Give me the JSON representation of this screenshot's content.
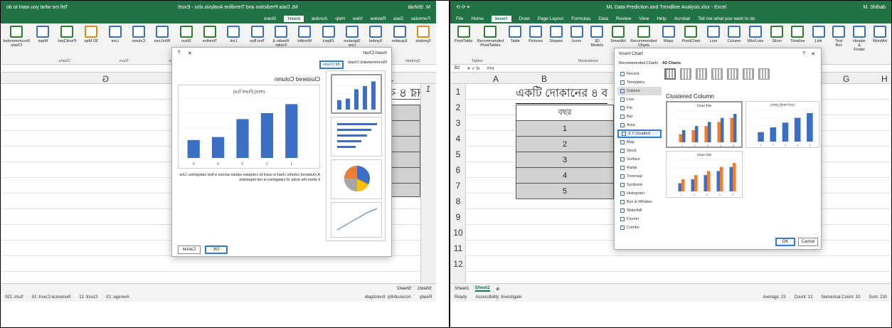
{
  "left": {
    "title_bar": {
      "app_title": "ML Data Prediction and Trendline Analysis.xlsx - Excel",
      "search_hint": "Tell me what you want to do",
      "user": "M. Shihab"
    },
    "tabs": [
      "Formulas",
      "Data",
      "Review",
      "View",
      "Help",
      "Acrobat",
      "Insert",
      "Share"
    ],
    "active_tab": "Insert",
    "share_label": "Share",
    "ribbon": [
      {
        "label": "Symbols",
        "type": "o"
      },
      {
        "label": "Equation",
        "type": "b"
      },
      {
        "label": "Symbol",
        "type": "b"
      },
      {
        "label": "Signature Line",
        "type": "b"
      },
      {
        "label": "Object",
        "type": "b"
      },
      {
        "label": "WordArt",
        "type": "b"
      },
      {
        "label": "Header & Footer",
        "type": "b"
      },
      {
        "label": "Text Box",
        "type": "b"
      },
      {
        "label": "Link",
        "type": "b"
      },
      {
        "label": "Timeline",
        "type": "g"
      },
      {
        "label": "Slicer",
        "type": "g"
      },
      {
        "label": "Win/Loss",
        "type": "b"
      },
      {
        "label": "Column",
        "type": "b"
      },
      {
        "label": "Line",
        "type": "b"
      },
      {
        "label": "3D Map",
        "type": "o"
      },
      {
        "label": "PivotChart",
        "type": "g"
      },
      {
        "label": "Maps",
        "type": "b"
      },
      {
        "label": "Recommended Charts",
        "type": "g"
      }
    ],
    "groups": [
      "Symbols",
      "Text",
      "Links",
      "Filters",
      "Sparklines",
      "Tours",
      "Charts"
    ],
    "col_headers": [
      "J",
      "I",
      "H",
      "G"
    ],
    "row_numbers": [
      "1"
    ],
    "dialog": {
      "title": "Insert Chart",
      "help": "?",
      "close": "✕",
      "tabs": [
        "Recommended Charts",
        "All Charts"
      ],
      "active_tab": "All Charts",
      "chart_name": "Clustered Column",
      "preview_title": "(বছর) (বিক্রয় চিত্র)",
      "description": "A clustered column chart is used to compare values across a few categories. Use it when the order of categories is not important.",
      "ok": "OK",
      "cancel": "Cancel"
    },
    "bengali_heading": "একটি দোকানের ৪ বছরের",
    "sheets": [
      "Sheet1",
      "Sheet2"
    ],
    "status": [
      "Ready",
      "Accessibility: Investigate",
      "Average: 23",
      "Count: 12",
      "Numerical Count: 10",
      "Sum: 230"
    ]
  },
  "right": {
    "title_bar": {
      "app_title": "ML Data Prediction and Trendline Analysis.xlsx - Excel",
      "user": "M. Shihab"
    },
    "tabs": [
      "File",
      "Home",
      "Insert",
      "Draw",
      "Page Layout",
      "Formulas",
      "Data",
      "Review",
      "View",
      "Help",
      "Acrobat",
      "Tell me what you want to do"
    ],
    "active_tab": "Insert",
    "ribbon": [
      {
        "label": "PivotTable",
        "type": "g"
      },
      {
        "label": "Recommended PivotTables",
        "type": "g"
      },
      {
        "label": "Table",
        "type": "b"
      },
      {
        "label": "Pictures",
        "type": "b"
      },
      {
        "label": "Shapes",
        "type": "b"
      },
      {
        "label": "Icons",
        "type": "b"
      },
      {
        "label": "3D Models",
        "type": "b"
      },
      {
        "label": "SmartArt",
        "type": "g"
      },
      {
        "label": "Recommended Charts",
        "type": "g"
      },
      {
        "label": "Maps",
        "type": "b"
      },
      {
        "label": "PivotChart",
        "type": "g"
      },
      {
        "label": "Line",
        "type": "b"
      },
      {
        "label": "Column",
        "type": "b"
      },
      {
        "label": "Win/Loss",
        "type": "b"
      },
      {
        "label": "Slicer",
        "type": "g"
      },
      {
        "label": "Timeline",
        "type": "g"
      },
      {
        "label": "Link",
        "type": "b"
      },
      {
        "label": "Text Box",
        "type": "b"
      },
      {
        "label": "Header & Footer",
        "type": "b"
      },
      {
        "label": "WordArt",
        "type": "b"
      }
    ],
    "groups": [
      "Tables",
      "Illustrations",
      "Links",
      "Text"
    ],
    "name_box": "B2",
    "formula_value": "বছর",
    "col_headers": [
      "A",
      "B",
      "G",
      "H"
    ],
    "row_numbers": [
      "1",
      "2",
      "3",
      "4",
      "5",
      "6",
      "7",
      "8",
      "9",
      "10",
      "11",
      "12"
    ],
    "heading": "একটি দোকানের ৪ ব",
    "table_header": "বছর",
    "table_values": [
      "1",
      "2",
      "3",
      "4",
      "5"
    ],
    "dialog": {
      "title": "Insert Chart",
      "help": "?",
      "close": "✕",
      "tabs": [
        "Recommended Charts",
        "All Charts"
      ],
      "active_tab": "All Charts",
      "chart_types": [
        "Recent",
        "Templates",
        "Column",
        "Line",
        "Pie",
        "Bar",
        "Area",
        "X Y (Scatter)",
        "Map",
        "Stock",
        "Surface",
        "Radar",
        "Treemap",
        "Sunburst",
        "Histogram",
        "Box & Whisker",
        "Waterfall",
        "Funnel",
        "Combo"
      ],
      "selected_type": "Column",
      "hover_type": "X Y (Scatter)",
      "chart_name": "Clustered Column",
      "preview_titles": [
        "Chart Title",
        "(বছর) (বিক্রয় চিত্র)",
        "Chart Title"
      ],
      "ok": "OK",
      "cancel": "Cancel"
    },
    "sheets": [
      "Sheet1",
      "Sheet2"
    ],
    "active_sheet": "Sheet2",
    "status": [
      "Ready",
      "Accessibility: Investigate",
      "Average: 23",
      "Count: 12",
      "Numerical Count: 10",
      "Sum: 230"
    ]
  },
  "chart_data": [
    {
      "type": "bar",
      "title": "",
      "categories": [
        "1",
        "2",
        "3",
        "4",
        "5"
      ],
      "series": [
        {
          "values": [
            9,
            7.5,
            6.5,
            3.5,
            3
          ]
        }
      ],
      "ylim": [
        0,
        10
      ]
    },
    {
      "type": "bar",
      "title": "",
      "categories": [
        "1",
        "2",
        "3",
        "4",
        "5"
      ],
      "series": [
        {
          "values": [
            2,
            3,
            4,
            5,
            6
          ]
        },
        {
          "values": [
            3,
            4,
            5,
            6,
            7
          ]
        }
      ]
    },
    {
      "type": "bar",
      "title": "",
      "categories": [
        "1",
        "2",
        "3",
        "4",
        "5"
      ],
      "series": [
        {
          "values": [
            2,
            3,
            4,
            5,
            6
          ]
        }
      ]
    }
  ],
  "colors": {
    "excel_green": "#217346",
    "bar_blue": "#3a6fc4",
    "bar_orange": "#ed7d31",
    "highlight": "#2f7bd4"
  }
}
